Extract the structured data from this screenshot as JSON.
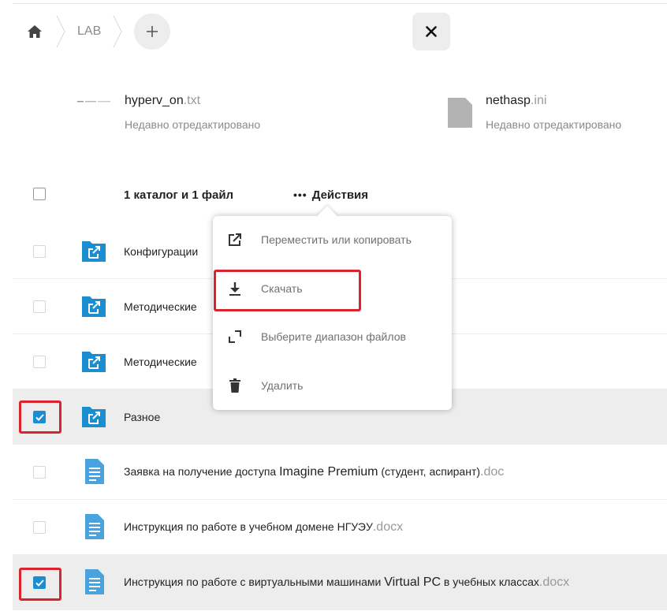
{
  "breadcrumb": {
    "folder": "LAB"
  },
  "recent": [
    {
      "name": "hyperv_on",
      "ext": ".txt",
      "subtitle": "Недавно отредактировано"
    },
    {
      "name": "nethasp",
      "ext": ".ini",
      "subtitle": "Недавно отредактировано"
    }
  ],
  "table_header": {
    "selection_summary": "1 каталог и 1 файл",
    "actions_label": "Действия"
  },
  "actions_menu": {
    "items": [
      {
        "label": "Переместить или копировать",
        "icon": "external-link-icon"
      },
      {
        "label": "Скачать",
        "icon": "download-icon"
      },
      {
        "label": "Выберите диапазон файлов",
        "icon": "range-select-icon"
      },
      {
        "label": "Удалить",
        "icon": "trash-icon"
      }
    ]
  },
  "rows": [
    {
      "type": "folder",
      "name": "Конфигурации",
      "checked": false
    },
    {
      "type": "folder",
      "name": "Методические",
      "checked": false
    },
    {
      "type": "folder",
      "name": "Методические",
      "checked": false
    },
    {
      "type": "folder",
      "name": "Разное",
      "checked": true
    },
    {
      "type": "file",
      "name_a": "Заявка на получение доступа ",
      "name_b": "Imagine Premium",
      "name_c": " (студент, аспирант)",
      "ext": ".doc",
      "checked": false
    },
    {
      "type": "file",
      "name_a": "Инструкция по работе в учебном домене НГУЭУ",
      "ext": ".docx",
      "checked": false
    },
    {
      "type": "file",
      "name_a": "Инструкция по работе с виртуальными машинами ",
      "name_b": "Virtual PC",
      "name_c": " в учебных классах",
      "ext": ".docx",
      "checked": true
    }
  ],
  "colors": {
    "accent": "#1a8ed1",
    "highlight": "#d9232e",
    "selected_row": "#ededed"
  }
}
